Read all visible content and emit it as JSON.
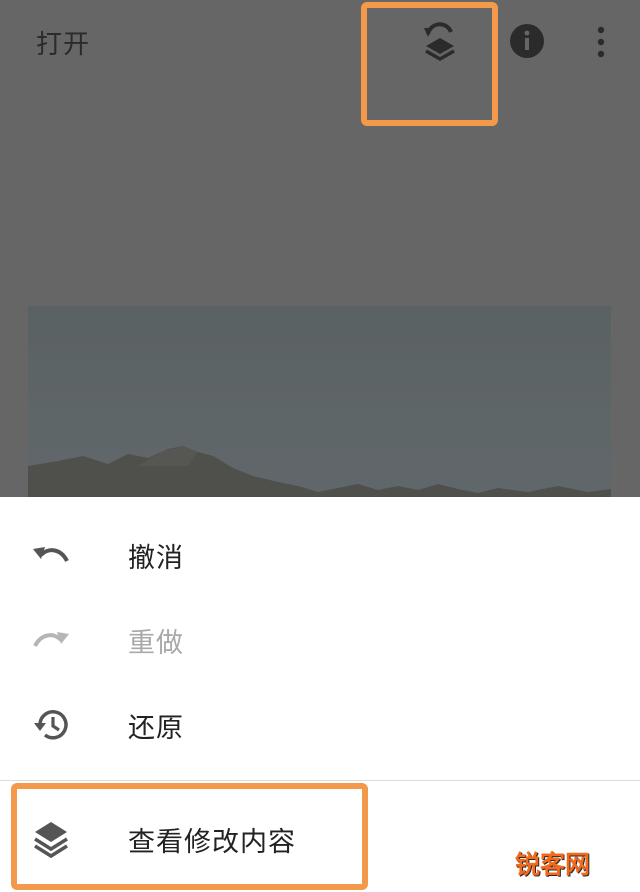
{
  "topbar": {
    "open_label": "打开",
    "history_icon": "history-layers-icon",
    "info_icon": "info-icon",
    "more_icon": "more-vert-icon"
  },
  "menu": {
    "items": [
      {
        "label": "撤消",
        "icon": "undo-icon",
        "enabled": true
      },
      {
        "label": "重做",
        "icon": "redo-icon",
        "enabled": false
      },
      {
        "label": "还原",
        "icon": "restore-history-icon",
        "enabled": true
      },
      {
        "label": "查看修改内容",
        "icon": "layers-icon",
        "enabled": true
      }
    ]
  },
  "watermark": {
    "text": "锐客网"
  },
  "colors": {
    "scrim": "#666666",
    "highlight": "#f39a4a",
    "sheet": "#ffffff",
    "text": "#222222",
    "disabled_text": "#a9a9a9"
  }
}
